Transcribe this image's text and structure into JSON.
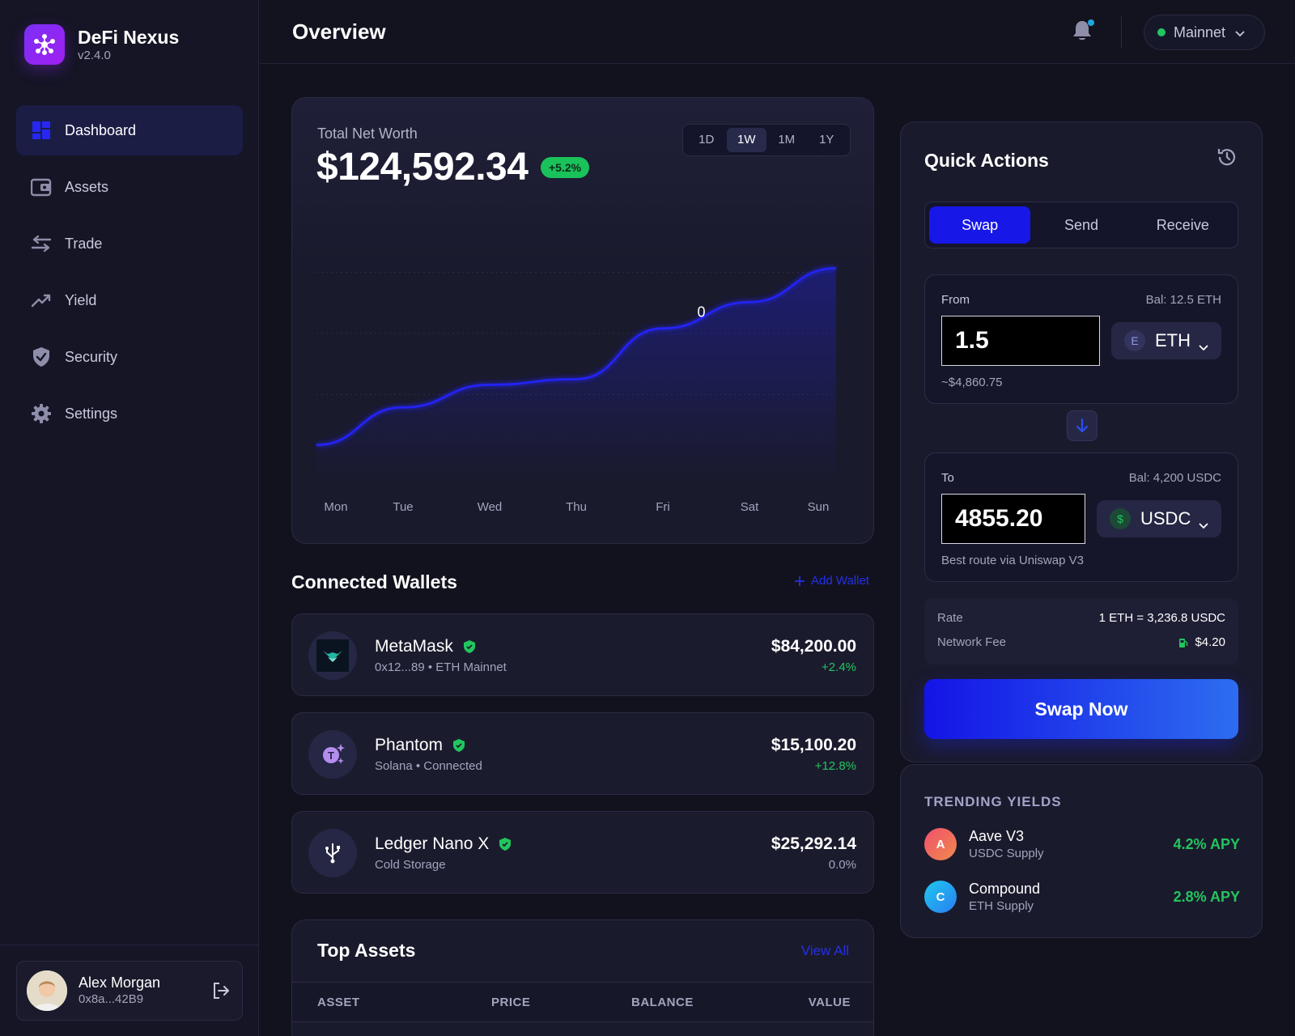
{
  "app": {
    "name": "DeFi Nexus",
    "version": "v2.4.0"
  },
  "sidebar": {
    "items": [
      {
        "label": "Dashboard",
        "icon": "dashboard-icon",
        "active": true
      },
      {
        "label": "Assets",
        "icon": "wallet-icon"
      },
      {
        "label": "Trade",
        "icon": "swap-arrows-icon"
      },
      {
        "label": "Yield",
        "icon": "trending-up-icon"
      },
      {
        "label": "Security",
        "icon": "shield-check-icon"
      },
      {
        "label": "Settings",
        "icon": "gear-icon"
      }
    ],
    "user": {
      "name": "Alex Morgan",
      "address": "0x8a...42B9"
    }
  },
  "header": {
    "title": "Overview",
    "network": "Mainnet"
  },
  "networth": {
    "label": "Total Net Worth",
    "value": "$124,592.34",
    "change": "+5.2%",
    "ranges": [
      "1D",
      "1W",
      "1M",
      "1Y"
    ],
    "active_range": "1W",
    "marker_label": "0"
  },
  "chart_data": {
    "type": "area",
    "x": [
      "Mon",
      "Tue",
      "Wed",
      "Thu",
      "Fri",
      "Sat",
      "Sun"
    ],
    "series": [
      {
        "values": [
          10,
          30,
          42,
          45,
          72,
          86,
          104
        ]
      }
    ],
    "ylim": [
      0,
      130
    ],
    "grid": true,
    "color": "#2323f0"
  },
  "wallets": {
    "title": "Connected Wallets",
    "add_label": "Add Wallet",
    "items": [
      {
        "name": "MetaMask",
        "sub": "0x12...89 • ETH Mainnet",
        "value": "$84,200.00",
        "change": "+2.4%",
        "change_color": "#22c55e",
        "icon": "metamask-fox-icon"
      },
      {
        "name": "Phantom",
        "sub": "Solana • Connected",
        "value": "$15,100.20",
        "change": "+12.8%",
        "change_color": "#22c55e",
        "icon": "phantom-icon"
      },
      {
        "name": "Ledger Nano X",
        "sub": "Cold Storage",
        "value": "$25,292.14",
        "change": "0.0%",
        "change_color": "#a3a3bd",
        "icon": "usb-icon"
      }
    ]
  },
  "top_assets": {
    "title": "Top Assets",
    "view_all": "View All",
    "columns": [
      "ASSET",
      "PRICE",
      "BALANCE",
      "VALUE"
    ]
  },
  "quick_actions": {
    "title": "Quick Actions",
    "tabs": [
      "Swap",
      "Send",
      "Receive"
    ],
    "active_tab": "Swap",
    "from": {
      "label": "From",
      "balance": "Bal: 12.5 ETH",
      "amount": "1.5",
      "token": "ETH",
      "token_letter": "E",
      "usd": "~$4,860.75"
    },
    "to": {
      "label": "To",
      "balance": "Bal: 4,200 USDC",
      "amount": "4855.20",
      "token": "USDC",
      "token_letter": "$",
      "note": "Best route via Uniswap V3"
    },
    "rate": {
      "label": "Rate",
      "value": "1 ETH = 3,236.8 USDC"
    },
    "fee": {
      "label": "Network Fee",
      "value": "$4.20"
    },
    "swap_button": "Swap Now"
  },
  "yields": {
    "title": "TRENDING YIELDS",
    "items": [
      {
        "letter": "A",
        "name": "Aave V3",
        "sub": "USDC Supply",
        "apy": "4.2% APY"
      },
      {
        "letter": "C",
        "name": "Compound",
        "sub": "ETH Supply",
        "apy": "2.8% APY"
      }
    ]
  }
}
